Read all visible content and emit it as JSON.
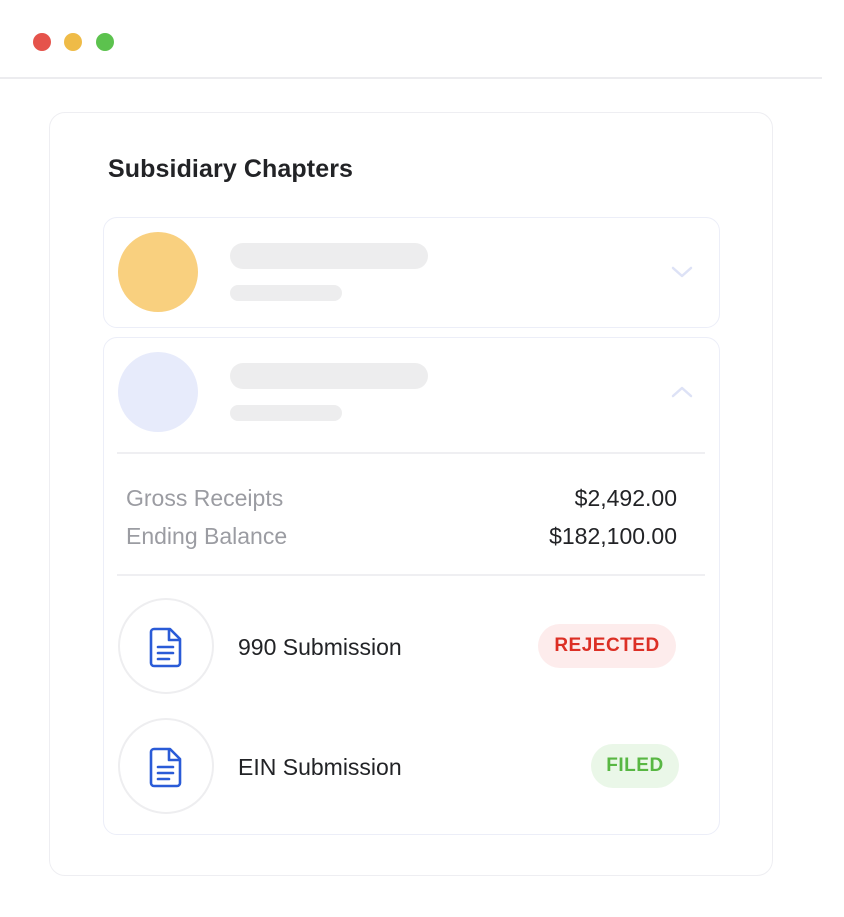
{
  "window": {
    "controls": [
      "close",
      "minimize",
      "maximize"
    ],
    "colors": {
      "close": "#e5534b",
      "minimize": "#efbb47",
      "maximize": "#5cc24e"
    }
  },
  "card": {
    "title": "Subsidiary Chapters"
  },
  "chapters": [
    {
      "state": "collapsed",
      "avatar_color": "#f9d07f",
      "chevron": "chevron-down-icon"
    },
    {
      "state": "expanded",
      "avatar_color": "#e7ebfb",
      "chevron": "chevron-up-icon"
    }
  ],
  "stats": [
    {
      "label": "Gross Receipts",
      "value": "$2,492.00"
    },
    {
      "label": "Ending Balance",
      "value": "$182,100.00"
    }
  ],
  "documents": [
    {
      "label": "990 Submission",
      "status": "REJECTED",
      "status_color": "#dc2f25",
      "icon": "document-icon"
    },
    {
      "label": "EIN Submission",
      "status": "FILED",
      "status_color": "#58b743",
      "icon": "document-icon"
    }
  ]
}
